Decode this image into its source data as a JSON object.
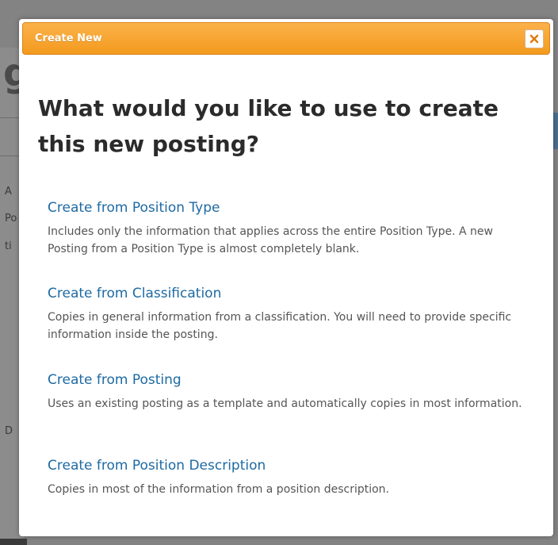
{
  "background": {
    "fragments": [
      "g",
      "A",
      "Po",
      "ti",
      "D"
    ]
  },
  "modal": {
    "title": "Create New",
    "question": "What would you like to use to create this new posting?",
    "options": [
      {
        "label": "Create from Position Type",
        "description": "Includes only the information that applies across the entire Position Type. A new Posting from a Position Type is almost completely blank."
      },
      {
        "label": "Create from Classification",
        "description": "Copies in general information from a classification. You will need to provide specific information inside the posting."
      },
      {
        "label": "Create from Posting",
        "description": "Uses an existing posting as a template and automatically copies in most information."
      },
      {
        "label": "Create from Position Description",
        "description": "Copies in most of the information from a position description."
      }
    ]
  },
  "colors": {
    "header_orange": "#f5a532",
    "link_blue": "#1d6aa3",
    "close_x": "#e07b12"
  },
  "icons": {
    "close": "close-icon"
  }
}
